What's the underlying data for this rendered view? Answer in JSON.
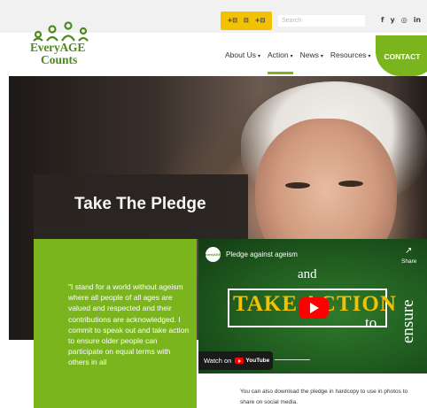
{
  "header": {
    "accessibility_tools": [
      "+⊟",
      "⊟",
      "+⊟"
    ],
    "search_placeholder": "Search",
    "social": [
      "f",
      "y",
      "◎",
      "in"
    ],
    "logo": {
      "line1": "EveryAGE",
      "line2": "Counts"
    }
  },
  "nav": {
    "items": [
      {
        "label": "About Us",
        "has_dropdown": true
      },
      {
        "label": "Action",
        "has_dropdown": true,
        "active": true
      },
      {
        "label": "News",
        "has_dropdown": true
      },
      {
        "label": "Resources",
        "has_dropdown": true
      }
    ],
    "contact_label": "CONTACT",
    "caret": "▾"
  },
  "hero": {
    "title": "Take The Pledge"
  },
  "pledge": {
    "text": "\"I stand for a world without ageism where all people of all ages are valued and respected and their contributions are acknowledged. I commit to speak out and take action to ensure older people can participate on equal terms with others in all"
  },
  "video": {
    "channel_avatar_text": "everyAGE",
    "title": "Pledge against ageism",
    "share_label": "Share",
    "share_icon": "↗",
    "overlay_and": "and",
    "overlay_take": "TAKE ACTION",
    "overlay_to": "to",
    "overlay_ensure": "ensure",
    "watch_on": "Watch on",
    "youtube_label": "YouTube"
  },
  "download_text": "You can also download the pledge in hardcopy to use in photos to share on social media.",
  "colors": {
    "brand_green": "#7ab51d",
    "accent_yellow": "#f2c200",
    "dark": "#2a2522"
  }
}
